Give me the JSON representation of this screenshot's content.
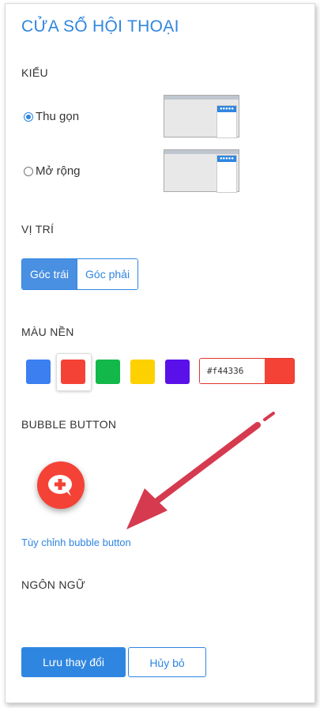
{
  "title": "CỬA SỔ HỘI THOẠI",
  "style": {
    "label": "KIỂU",
    "options": [
      {
        "label": "Thu gọn",
        "selected": true
      },
      {
        "label": "Mở rộng",
        "selected": false
      }
    ]
  },
  "position": {
    "label": "VỊ TRÍ",
    "options": [
      {
        "label": "Góc trái",
        "active": true
      },
      {
        "label": "Góc phải",
        "active": false
      }
    ]
  },
  "background": {
    "label": "MÀU NỀN",
    "swatches": [
      "#3b7ff0",
      "#f44336",
      "#12b84a",
      "#fdd000",
      "#5a10e8"
    ],
    "selected_index": 1,
    "hex_value": "#f44336"
  },
  "bubble": {
    "label": "BUBBLE BUTTON",
    "icon": "chat-plus-icon",
    "customize_link": "Tùy chỉnh bubble button"
  },
  "language": {
    "label": "NGÔN NGỮ"
  },
  "actions": {
    "save": "Lưu thay đổi",
    "cancel": "Hủy bỏ"
  },
  "colors": {
    "accent": "#2f86e0",
    "bubble": "#f44336",
    "arrow": "#d63a4e"
  }
}
